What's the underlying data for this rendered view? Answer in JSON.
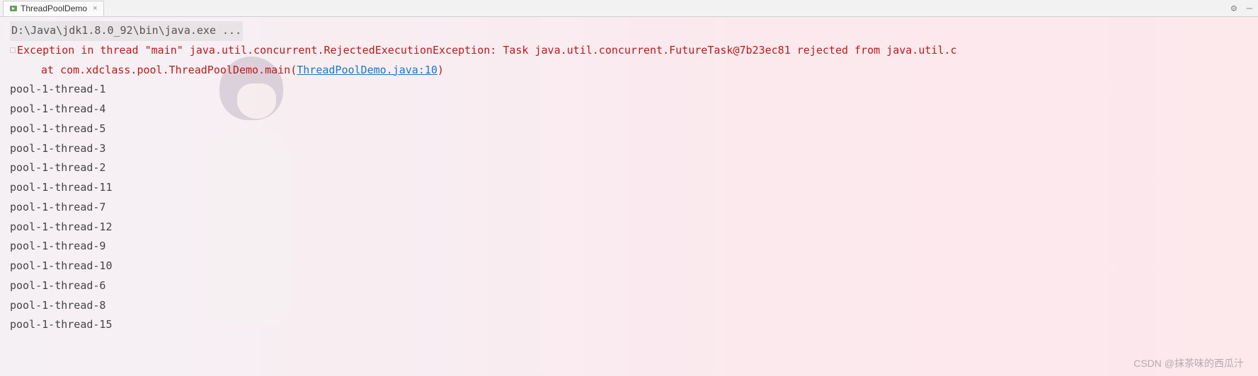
{
  "tab": {
    "title": "ThreadPoolDemo",
    "close_glyph": "×"
  },
  "toolbar": {
    "gear_glyph": "⚙",
    "minimize_glyph": "—"
  },
  "console": {
    "command": "D:\\Java\\jdk1.8.0_92\\bin\\java.exe ...",
    "exception_line": "Exception in thread \"main\" java.util.concurrent.RejectedExecutionException: Task java.util.concurrent.FutureTask@7b23ec81 rejected from java.util.c",
    "stack_prefix": "at com.xdclass.pool.ThreadPoolDemo.main(",
    "stack_link": "ThreadPoolDemo.java:10",
    "stack_suffix": ")",
    "output": [
      "pool-1-thread-1",
      "pool-1-thread-4",
      "pool-1-thread-5",
      "pool-1-thread-3",
      "pool-1-thread-2",
      "pool-1-thread-11",
      "pool-1-thread-7",
      "pool-1-thread-12",
      "pool-1-thread-9",
      "pool-1-thread-10",
      "pool-1-thread-6",
      "pool-1-thread-8",
      "pool-1-thread-15"
    ]
  },
  "watermark": "CSDN @抹茶味的西瓜汁"
}
